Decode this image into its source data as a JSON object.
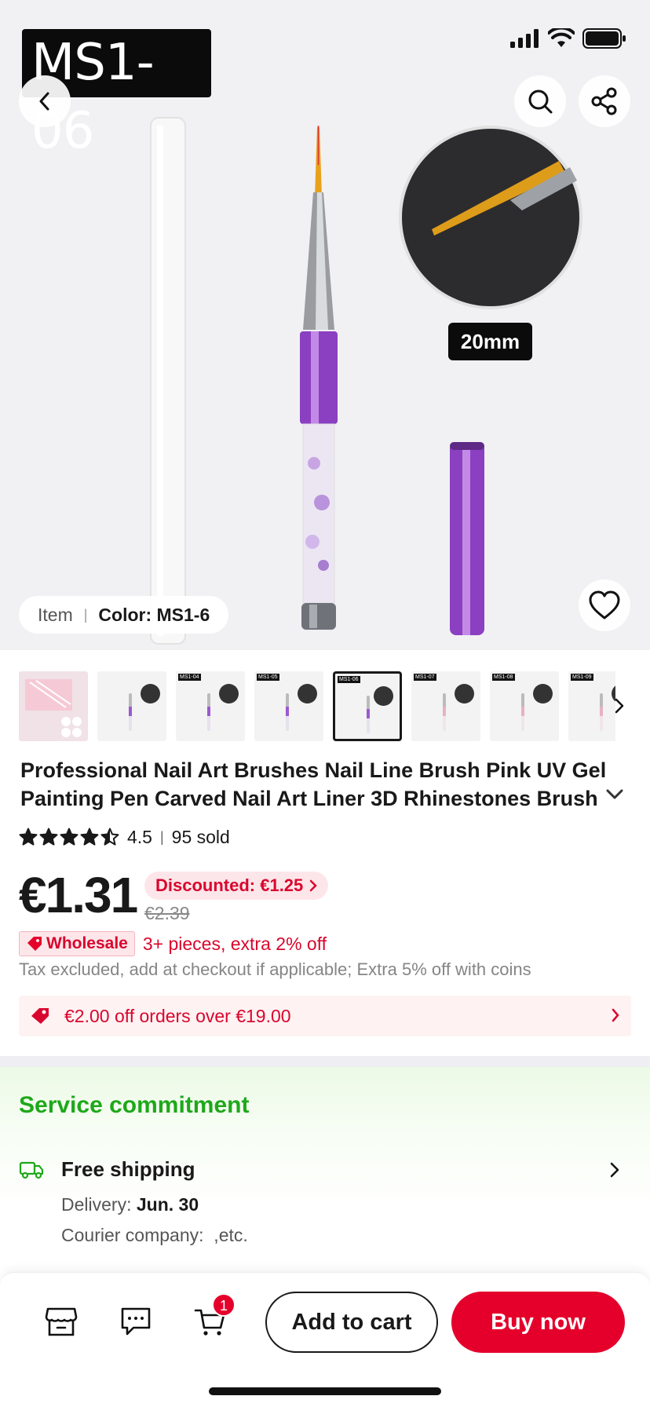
{
  "hero": {
    "variant_overlay": "MS1-06",
    "size_tag": "20mm",
    "item_label": "Item",
    "color_label": "Color: MS1-6"
  },
  "thumbnails": [
    {
      "label": ""
    },
    {
      "label": ""
    },
    {
      "label": "MS1-04"
    },
    {
      "label": "MS1-05"
    },
    {
      "label": "MS1-06",
      "selected": true
    },
    {
      "label": "MS1-07"
    },
    {
      "label": "MS1-08"
    },
    {
      "label": "MS1-09"
    }
  ],
  "product": {
    "title": "Professional Nail Art Brushes Nail Line Brush Pink UV Gel Painting Pen Carved Nail Art Liner 3D Rhinestones Brush f",
    "rating": "4.5",
    "rating_value": 4.5,
    "sold": "95 sold",
    "price": "€1.31",
    "discounted": "Discounted: €1.25",
    "original_price": "€2.39",
    "wholesale_badge": "Wholesale",
    "wholesale_text": "3+ pieces, extra 2% off",
    "tax_note": "Tax excluded, add at checkout if applicable; Extra 5% off with coins",
    "coupon": "€2.00 off orders over €19.00"
  },
  "service": {
    "title": "Service commitment",
    "shipping_title": "Free shipping",
    "delivery_label": "Delivery:",
    "delivery_date": "Jun. 30",
    "courier": "Courier company:  ,etc."
  },
  "bottom_bar": {
    "cart_count": "1",
    "add_to_cart": "Add to cart",
    "buy_now": "Buy now"
  },
  "colors": {
    "accent_red": "#e4002b",
    "service_green": "#1ea81a",
    "star": "#191919"
  }
}
